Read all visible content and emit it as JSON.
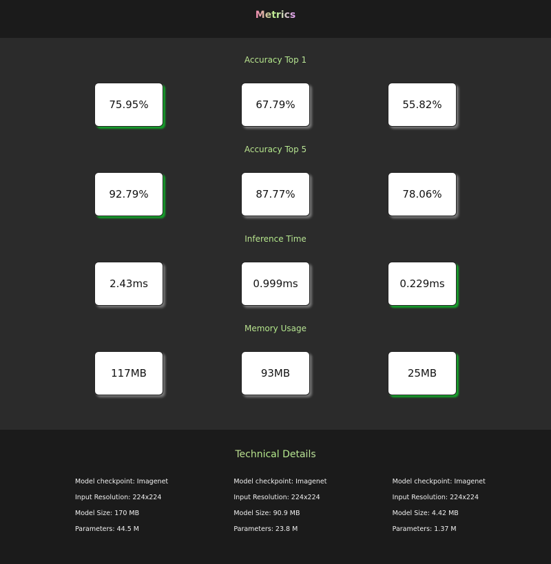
{
  "header": {
    "title": "Metrics"
  },
  "metrics": [
    {
      "title": "Accuracy Top 1",
      "values": [
        "75.95%",
        "67.79%",
        "55.82%"
      ],
      "best_index": 0
    },
    {
      "title": "Accuracy Top 5",
      "values": [
        "92.79%",
        "87.77%",
        "78.06%"
      ],
      "best_index": 0
    },
    {
      "title": "Inference Time",
      "values": [
        "2.43ms",
        "0.999ms",
        "0.229ms"
      ],
      "best_index": 2
    },
    {
      "title": "Memory Usage",
      "values": [
        "117MB",
        "93MB",
        "25MB"
      ],
      "best_index": 2
    }
  ],
  "technical": {
    "title": "Technical Details",
    "models": [
      {
        "checkpoint": "Model checkpoint: Imagenet",
        "resolution": "Input Resolution: 224x224",
        "size": "Model Size: 170 MB",
        "params": "Parameters: 44.5 M"
      },
      {
        "checkpoint": "Model checkpoint: Imagenet",
        "resolution": "Input Resolution: 224x224",
        "size": "Model Size: 90.9 MB",
        "params": "Parameters: 23.8 M"
      },
      {
        "checkpoint": "Model checkpoint: Imagenet",
        "resolution": "Input Resolution: 224x224",
        "size": "Model Size: 4.42 MB",
        "params": "Parameters: 1.37 M"
      }
    ]
  },
  "colors": {
    "highlight_shadow": "#15a02a",
    "panel_bg": "#2b2b2b",
    "page_bg": "#1b1b1b"
  }
}
